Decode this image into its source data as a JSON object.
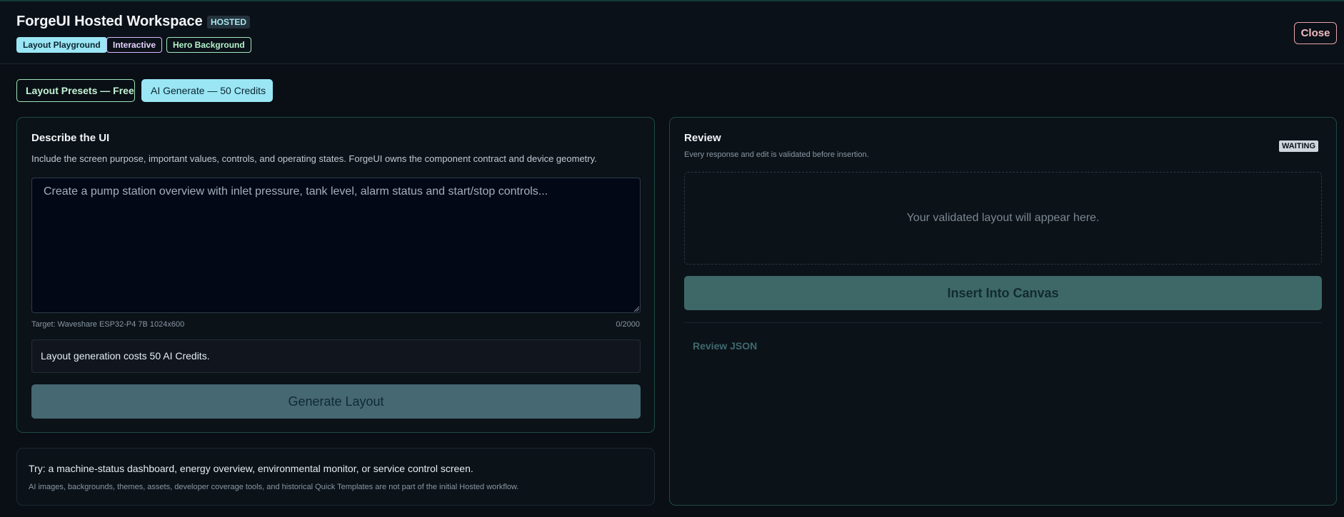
{
  "header": {
    "title": "ForgeUI Hosted Workspace",
    "badge": "HOSTED",
    "pills": [
      "Layout Playground",
      "Interactive",
      "Hero Background"
    ],
    "close_label": "Close"
  },
  "modes": {
    "presets_label": "Layout Presets — Free",
    "ai_label": "AI Generate — 50 Credits"
  },
  "describe": {
    "title": "Describe the UI",
    "subtitle": "Include the screen purpose, important values, controls, and operating states. ForgeUI owns the component contract and device geometry.",
    "placeholder": "Create a pump station overview with inlet pressure, tank level, alarm status and start/stop controls...",
    "value": "",
    "target": "Target: Waveshare ESP32-P4 7B 1024x600",
    "counter": "0/2000",
    "cost_notice": "Layout generation costs 50 AI Credits.",
    "generate_label": "Generate Layout"
  },
  "review": {
    "title": "Review",
    "subtitle": "Every response and edit is validated before insertion.",
    "status": "WAITING",
    "empty_text": "Your validated layout will appear here.",
    "insert_label": "Insert Into Canvas",
    "json_label": "Review JSON"
  },
  "tips": {
    "line1": "Try: a machine-status dashboard, energy overview, environmental monitor, or service control screen.",
    "line2": "AI images, backgrounds, themes, assets, developer coverage tools, and historical Quick Templates are not part of the initial Hosted workflow."
  },
  "colors": {
    "accent_cyan": "#9ae6f5",
    "accent_green": "#a3e8bd",
    "accent_purple": "#d5b7ff",
    "close_red": "#e8a2aa",
    "generate_button": "#466873",
    "insert_button": "#3e6868"
  }
}
